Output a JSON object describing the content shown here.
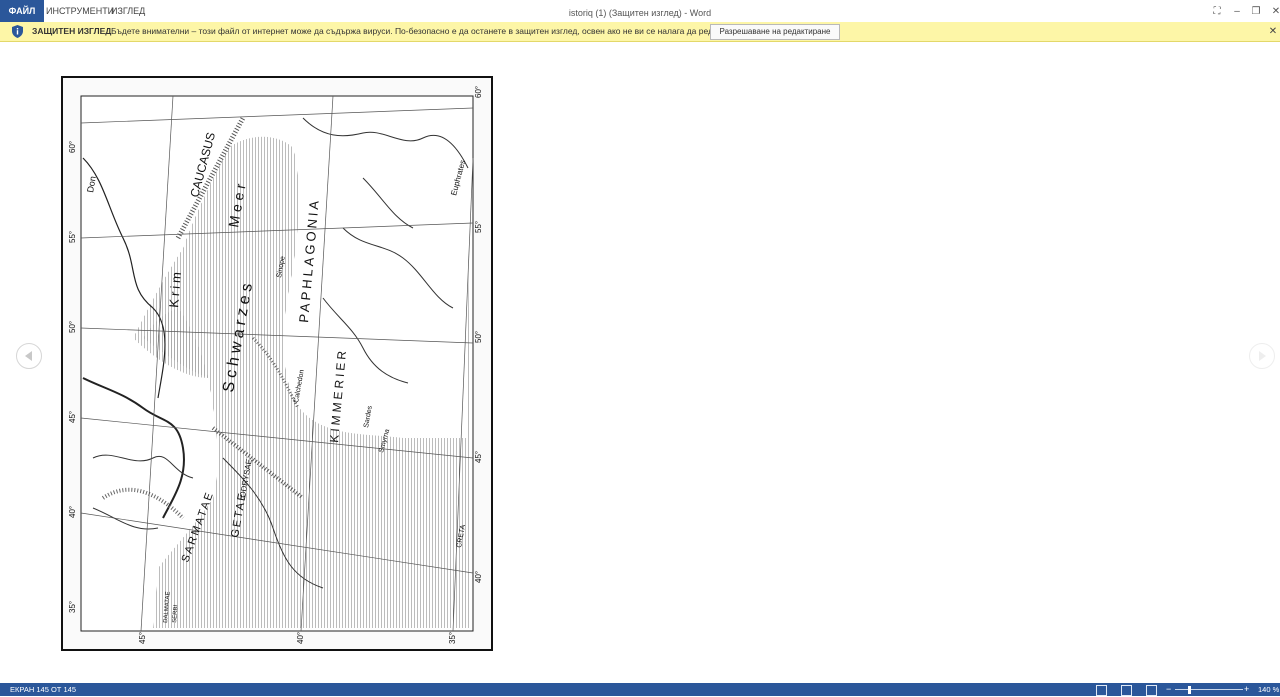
{
  "window": {
    "title": "istoriq (1) (Защитен изглед) - Word",
    "controls": {
      "fullscreen": "⛶",
      "minimize": "–",
      "restore": "❐",
      "close": "✕"
    }
  },
  "menu": {
    "file": "ФАЙЛ",
    "tools": "ИНСТРУМЕНТИ",
    "view": "ИЗГЛЕД"
  },
  "protected_view": {
    "title": "ЗАЩИТЕН ИЗГЛЕД",
    "message": "Бъдете внимателни – този файл от интернет може да съдържа вируси. По-безопасно е да останете в защитен изглед, освен ако не ви се налага да редактирате.",
    "enable_button": "Разрешаване на редактиране",
    "close": "✕",
    "icon": "shield-icon"
  },
  "map": {
    "labels": {
      "caucasus": "CAUCASUS",
      "meer": "Meer",
      "schwarzes": "Schwarzes",
      "paphlagonia": "PAPHLAGONIA",
      "kimmerier": "KIMMERIER",
      "krim": "Krim",
      "don": "Don",
      "sinope": "Sinope",
      "euphrates": "Euphrates",
      "sarmatae": "SARMATAE",
      "odrysae": "ODRYSAE",
      "getae": "GETAE",
      "dalmatae": "DALMATAE",
      "serbi": "SERBI",
      "smyrna": "Smyrna",
      "chalcedon": "Calchedon",
      "sardes": "Sardes",
      "creta": "CRETA"
    },
    "lat_left": [
      "60°",
      "55°",
      "50°",
      "45°",
      "40°",
      "35°"
    ],
    "lat_right": [
      "60°",
      "55°",
      "50°",
      "45°",
      "40°"
    ],
    "lon_bottom": [
      "45°",
      "40°",
      "35°"
    ]
  },
  "statusbar": {
    "page": "ЕКРАН 145 ОТ 145",
    "zoom": "140 %",
    "zoom_value_percent": 140
  },
  "colors": {
    "accent": "#2b579a",
    "protected_bg": "#fdf6a7"
  }
}
